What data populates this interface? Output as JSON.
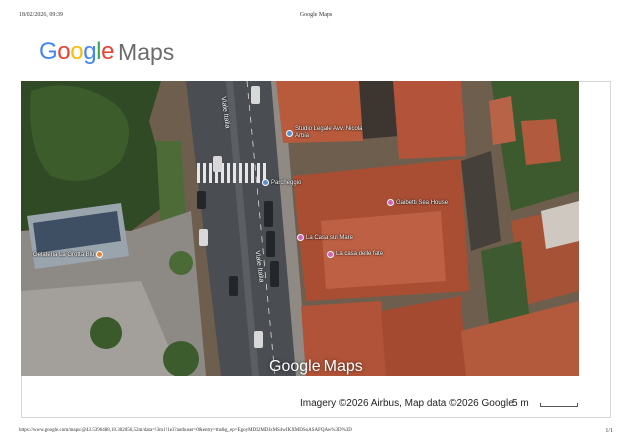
{
  "print_header": {
    "date": "18/02/2026, 09:39",
    "title": "Google Maps"
  },
  "logo": {
    "letters": [
      "G",
      "o",
      "o",
      "g",
      "l",
      "e"
    ],
    "product": "Maps"
  },
  "colors": {
    "google_blue": "#4285F4",
    "google_red": "#EA4335",
    "google_yellow": "#FBBC05",
    "google_green": "#34A853",
    "poi_blue": "#5a8fd6",
    "poi_pink": "#d35fb7",
    "poi_orange": "#e8832d"
  },
  "map": {
    "type": "satellite",
    "streets": {
      "viale_italia_top": "Viale Italia",
      "viale_italia_bottom": "Viale Italia"
    },
    "pois": [
      {
        "name": "Studio Legale Avv. Nicola Arbia",
        "icon": "pin-icon"
      },
      {
        "name": "Parcheggio",
        "icon": "parking-icon"
      },
      {
        "name": "Gelateria La Grotta Blu",
        "icon": "food-icon"
      },
      {
        "name": "Gaibetti Sea House",
        "icon": "bed-icon"
      },
      {
        "name": "La Casa sul Mare",
        "icon": "bed-icon"
      },
      {
        "name": "La casa delle fate",
        "icon": "bed-icon"
      }
    ],
    "watermark_maps": "Maps"
  },
  "attribution": "Imagery ©2026 Airbus, Map data ©2026 Google",
  "scale": {
    "label": "5 m"
  },
  "print_footer": {
    "url": "https://www.google.com/maps/@43.5396488,10.302056,52m/data=!3m1!1e3?authuser=0&entry=ttu&g_ep=EgoyMDI2MDIxMS4wIKXMDSoASAFQAw%3D%3D",
    "page": "1/1"
  }
}
